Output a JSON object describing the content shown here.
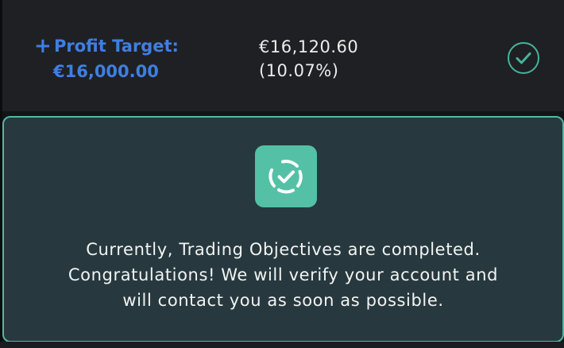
{
  "profit_target": {
    "plus_symbol": "+",
    "label": "Profit Target:",
    "amount": "€16,000.00"
  },
  "current": {
    "amount": "€16,120.60",
    "percent": "(10.07%)"
  },
  "status": {
    "icon": "check-circle-icon",
    "completed": true
  },
  "completion_card": {
    "icon": "verified-badge-icon",
    "message_lines": [
      "Currently, Trading Objectives are completed.",
      "Congratulations! We will verify your account and",
      "will contact you as soon as possible."
    ]
  },
  "colors": {
    "accent_blue": "#3f7fe3",
    "success_green": "#52b8a2",
    "card_bg": "#27393e",
    "row_bg": "#1f2024"
  }
}
